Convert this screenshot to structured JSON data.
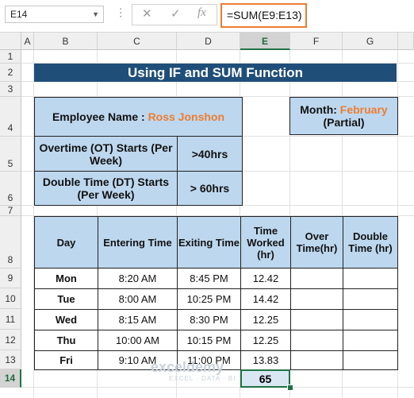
{
  "formula_bar": {
    "name_box": "E14",
    "cancel_icon": "✕",
    "enter_icon": "✓",
    "fx_icon": "fx",
    "formula": "=SUM(E9:E13)"
  },
  "columns": [
    "A",
    "B",
    "C",
    "D",
    "E",
    "F",
    "G"
  ],
  "rows": [
    "1",
    "2",
    "3",
    "4",
    "5",
    "6",
    "7",
    "8",
    "9",
    "10",
    "11",
    "12",
    "13",
    "14"
  ],
  "selected_cell": {
    "column": "E",
    "row": "14"
  },
  "title": "Using IF and SUM Function",
  "employee": {
    "label": "Employee Name : ",
    "name": "Ross Jonshon"
  },
  "month": {
    "label": "Month: ",
    "value": "February",
    "note": "(Partial)"
  },
  "overtime": {
    "label": "Overtime (OT) Starts (Per Week)",
    "value": ">40hrs"
  },
  "double_time": {
    "label": "Double Time (DT) Starts (Per Week)",
    "value": "> 60hrs"
  },
  "table": {
    "headers": [
      "Day",
      "Entering Time",
      "Exiting Time",
      "Time Worked (hr)",
      "Over Time(hr)",
      "Double Time (hr)"
    ],
    "rows": [
      {
        "day": "Mon",
        "enter": "8:20 AM",
        "exit": "8:45 PM",
        "worked": "12.42",
        "ot": "",
        "dt": ""
      },
      {
        "day": "Tue",
        "enter": "8:00 AM",
        "exit": "10:25 PM",
        "worked": "14.42",
        "ot": "",
        "dt": ""
      },
      {
        "day": "Wed",
        "enter": "8:15 AM",
        "exit": "8:30 PM",
        "worked": "12.25",
        "ot": "",
        "dt": ""
      },
      {
        "day": "Thu",
        "enter": "10:00 AM",
        "exit": "10:15 PM",
        "worked": "12.25",
        "ot": "",
        "dt": ""
      },
      {
        "day": "Fri",
        "enter": "9:10 AM",
        "exit": "11:00 PM",
        "worked": "13.83",
        "ot": "",
        "dt": ""
      }
    ],
    "total": "65"
  },
  "watermark": {
    "brand": "exceldemy",
    "tagline": "EXCEL · DATA · BI"
  },
  "colors": {
    "title_bg": "#1f4e79",
    "header_bg": "#bdd7ee",
    "accent_orange": "#ed7d31",
    "excel_green": "#217346"
  }
}
